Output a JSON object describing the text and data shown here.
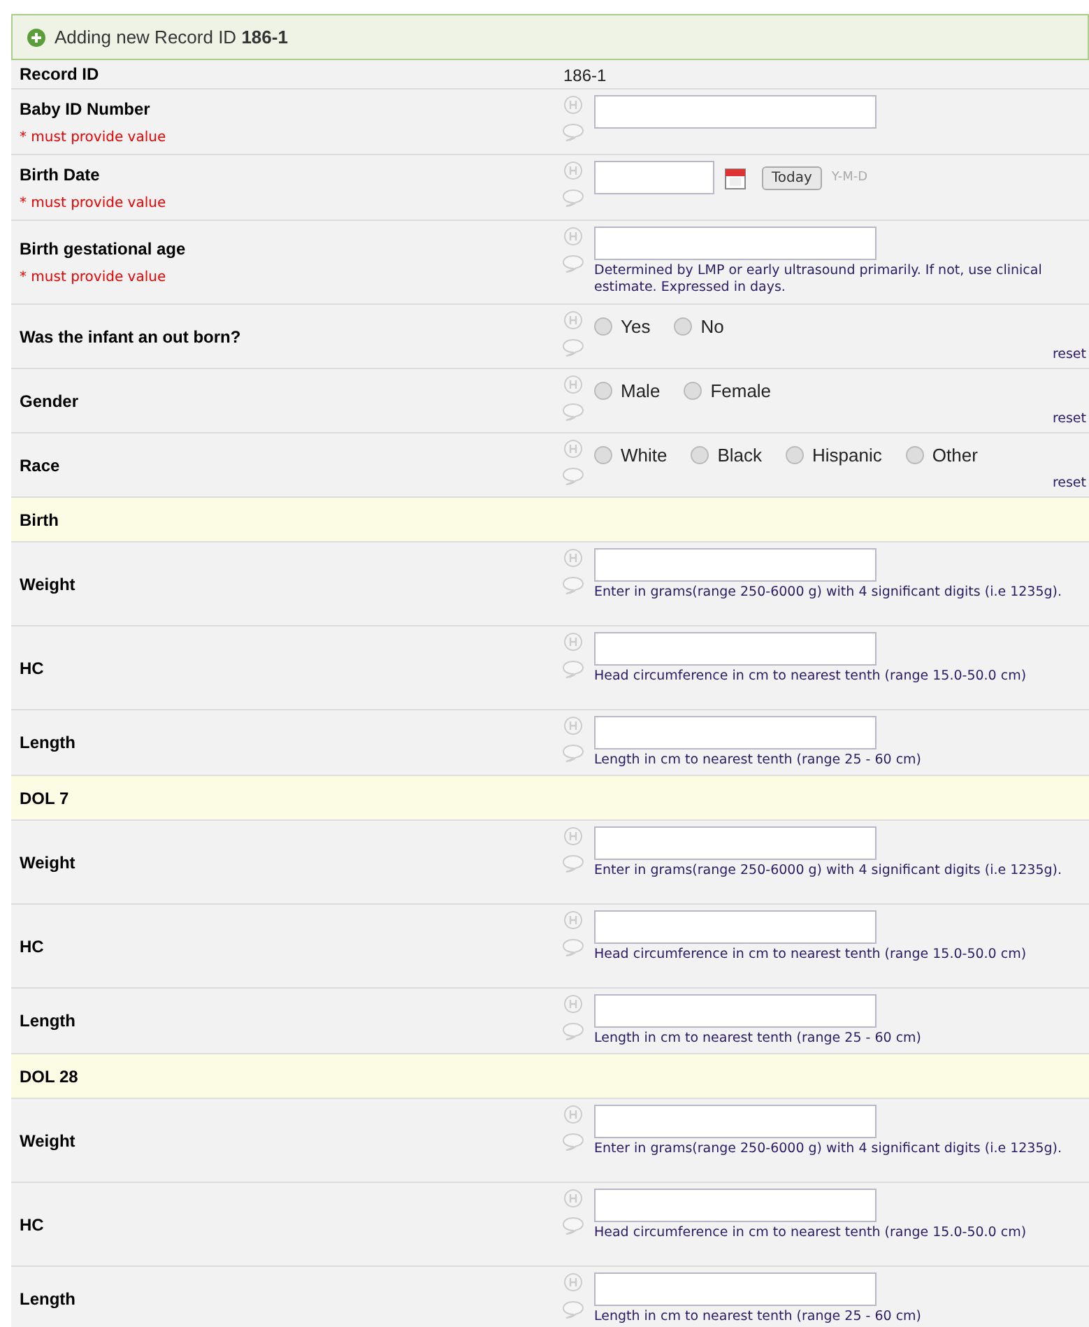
{
  "header": {
    "text": "Adding new Record ID **186-1**"
  },
  "rows": [
    {
      "kind": "value",
      "label": "Record ID",
      "value": "186-1"
    },
    {
      "kind": "input",
      "label": "Baby ID Number",
      "required_text": "* must provide value"
    },
    {
      "kind": "date",
      "label": "Birth Date",
      "required_text": "* must provide value",
      "button": "Today",
      "format": "Y-M-D"
    },
    {
      "kind": "input",
      "label": "Birth gestational age",
      "required_text": "* must provide value",
      "note": "Determined by LMP or early ultrasound primarily. If not, use clinical estimate. Expressed in days."
    },
    {
      "kind": "radio",
      "label": "Was the infant an out born?",
      "options": [
        {
          "label": "Yes",
          "selected": false
        },
        {
          "label": "No",
          "selected": false
        }
      ],
      "reset": "reset"
    },
    {
      "kind": "radio",
      "label": "Gender",
      "options": [
        {
          "label": "Male",
          "selected": false
        },
        {
          "label": "Female",
          "selected": false
        }
      ],
      "reset": "reset"
    },
    {
      "kind": "radio",
      "label": "Race",
      "options": [
        {
          "label": "White",
          "selected": false
        },
        {
          "label": "Black",
          "selected": false
        },
        {
          "label": "Hispanic",
          "selected": false
        },
        {
          "label": "Other",
          "selected": false
        }
      ],
      "reset": "reset"
    },
    {
      "kind": "section",
      "label": "Birth"
    },
    {
      "kind": "input",
      "label": "Weight",
      "note": "Enter in grams(range 250-6000 g) with 4 significant digits (i.e 1235g)."
    },
    {
      "kind": "input",
      "label": "HC",
      "note": "Head circumference in cm to nearest tenth (range 15.0-50.0 cm)"
    },
    {
      "kind": "input",
      "label": "Length",
      "note": "Length in cm to nearest tenth (range 25 - 60 cm)"
    },
    {
      "kind": "section",
      "label": "DOL 7"
    },
    {
      "kind": "input",
      "label": "Weight",
      "note": "Enter in grams(range 250-6000 g) with 4 significant digits (i.e 1235g)."
    },
    {
      "kind": "input",
      "label": "HC",
      "note": "Head circumference in cm to nearest tenth (range 15.0-50.0 cm)"
    },
    {
      "kind": "input",
      "label": "Length",
      "note": "Length in cm to nearest tenth (range 25 - 60 cm)"
    },
    {
      "kind": "section",
      "label": "DOL 28"
    },
    {
      "kind": "input",
      "label": "Weight",
      "note": "Enter in grams(range 250-6000 g) with 4 significant digits (i.e 1235g)."
    },
    {
      "kind": "input",
      "label": "HC",
      "note": "Head circumference in cm to nearest tenth (range 15.0-50.0 cm)"
    },
    {
      "kind": "input",
      "label": "Length",
      "note": "Length in cm to nearest tenth (range 25 - 60 cm)"
    }
  ]
}
